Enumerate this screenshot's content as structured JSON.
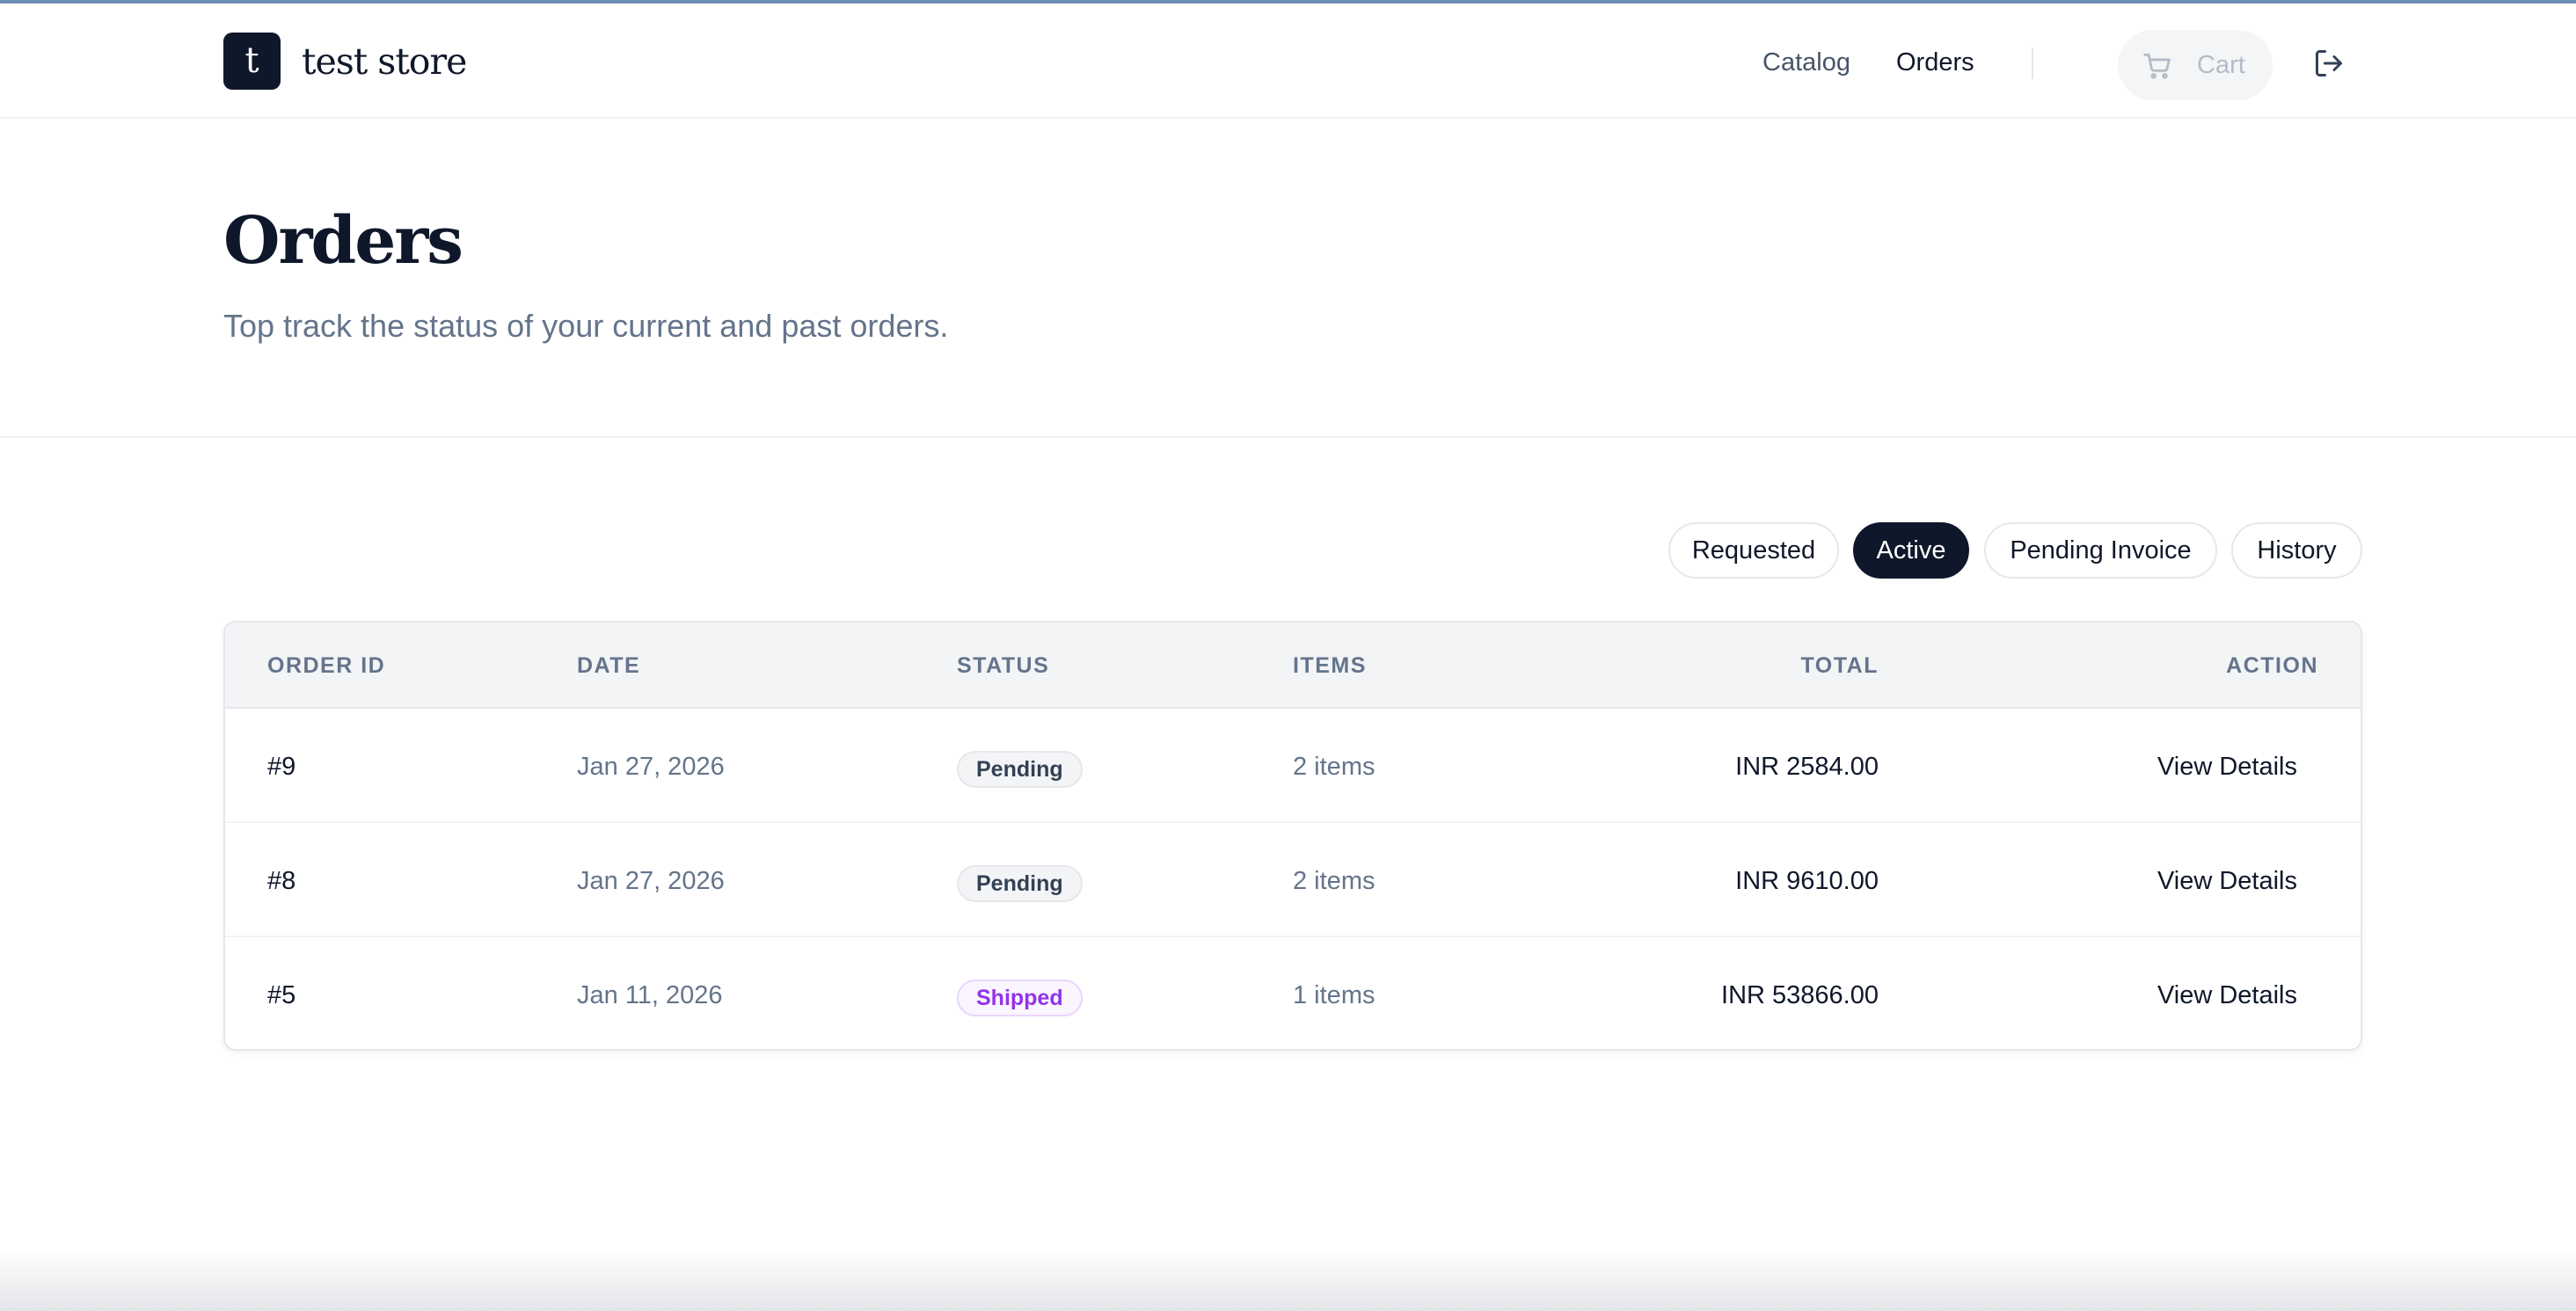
{
  "header": {
    "logo_letter": "t",
    "brand": "test store",
    "nav": {
      "catalog": "Catalog",
      "orders": "Orders"
    },
    "cart_label": "Cart"
  },
  "page": {
    "title": "Orders",
    "subtitle": "Top track the status of your current and past orders."
  },
  "tabs": [
    {
      "label": "Requested",
      "selected": false
    },
    {
      "label": "Active",
      "selected": true
    },
    {
      "label": "Pending Invoice",
      "selected": false
    },
    {
      "label": "History",
      "selected": false
    }
  ],
  "table": {
    "columns": [
      "ORDER ID",
      "DATE",
      "STATUS",
      "ITEMS",
      "TOTAL",
      "ACTION"
    ],
    "rows": [
      {
        "id": "#9",
        "date": "Jan 27, 2026",
        "status": "Pending",
        "items": "2 items",
        "total": "INR 2584.00",
        "action": "View Details"
      },
      {
        "id": "#8",
        "date": "Jan 27, 2026",
        "status": "Pending",
        "items": "2 items",
        "total": "INR 9610.00",
        "action": "View Details"
      },
      {
        "id": "#5",
        "date": "Jan 11, 2026",
        "status": "Shipped",
        "items": "1 items",
        "total": "INR 53866.00",
        "action": "View Details"
      }
    ]
  },
  "colors": {
    "primary": "#0f172a",
    "muted_text": "#64748b",
    "pending_badge": "#334155",
    "shipped_badge": "#9333ea"
  },
  "icons": {
    "cart": "cart-icon",
    "logout": "logout-icon"
  }
}
